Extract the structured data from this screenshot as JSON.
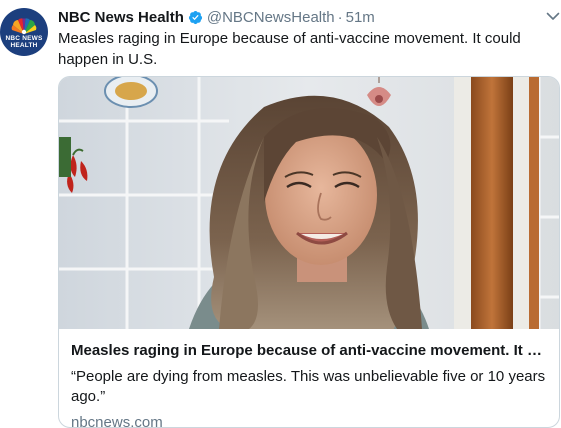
{
  "tweet": {
    "author": {
      "name": "NBC News Health",
      "handle": "@NBCNewsHealth",
      "separator": "·",
      "time": "51m",
      "avatar_logo_line1": "NBC NEWS",
      "avatar_logo_line2": "HEALTH",
      "verified_icon": "verified-badge-icon"
    },
    "text": "Measles raging in Europe because of anti-vaccine movement. It could happen in U.S.",
    "menu_icon": "chevron-down-icon",
    "card": {
      "title": "Measles raging in Europe because of anti-vaccine movement. It coul...",
      "description": "“People are dying from measles. This was unbelievable five or 10 years ago.”",
      "domain": "nbcnews.com",
      "image": "photo-of-smiling-woman-in-kitchen"
    }
  },
  "colors": {
    "text_primary": "#14171a",
    "text_secondary": "#657786",
    "border": "#ccd6dd",
    "verified": "#1da1f2",
    "avatar_bg": "#1c3f7e"
  }
}
